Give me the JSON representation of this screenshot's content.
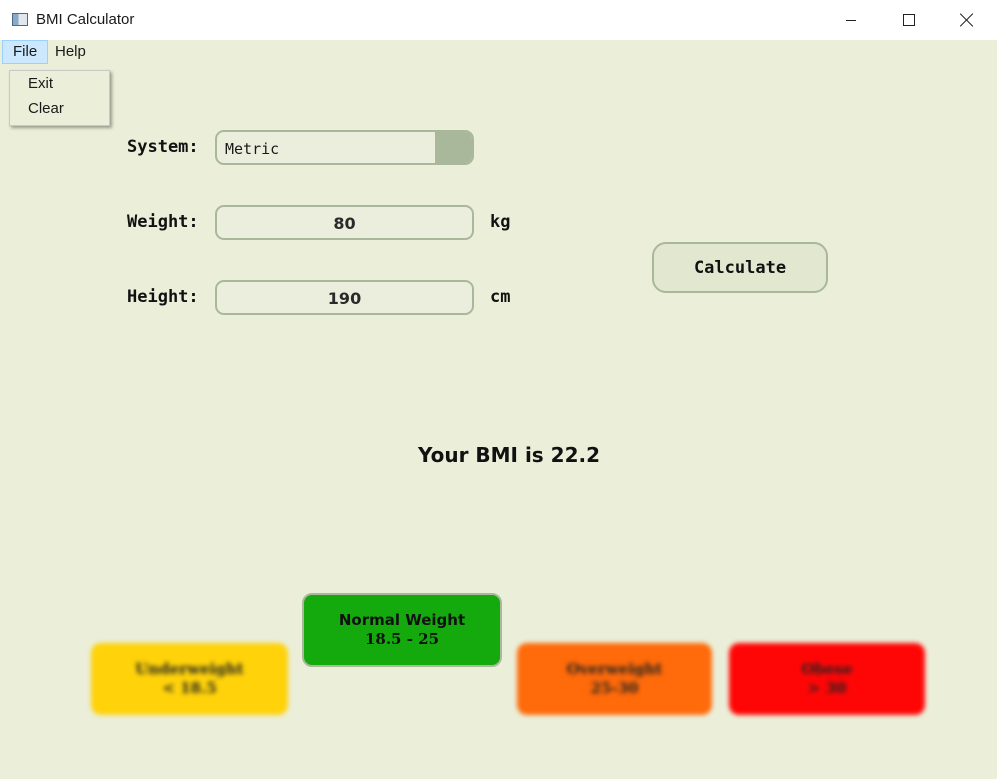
{
  "window": {
    "title": "BMI Calculator"
  },
  "menubar": {
    "file": "File",
    "help": "Help"
  },
  "file_menu": {
    "items": [
      "Exit",
      "Clear"
    ]
  },
  "form": {
    "system_label": "System:",
    "system_value": "Metric",
    "weight_label": "Weight:",
    "weight_value": "80",
    "weight_unit": "kg",
    "height_label": "Height:",
    "height_value": "190",
    "height_unit": "cm"
  },
  "calculate_label": "Calculate",
  "result_text": "Your BMI is 22.2",
  "categories": [
    {
      "name": "Underweight",
      "range": "< 18.5",
      "color": "#ffd20a"
    },
    {
      "name": "Normal Weight",
      "range": "18.5 - 25",
      "color": "#14aa0e"
    },
    {
      "name": "Overweight",
      "range": "25-30",
      "color": "#ff6a0a"
    },
    {
      "name": "Obese",
      "range": "> 30",
      "color": "#ff0606"
    }
  ],
  "colors": {
    "background": "#ebefd9",
    "field_border": "#a9b89a",
    "menu_highlight": "#cce8ff"
  }
}
